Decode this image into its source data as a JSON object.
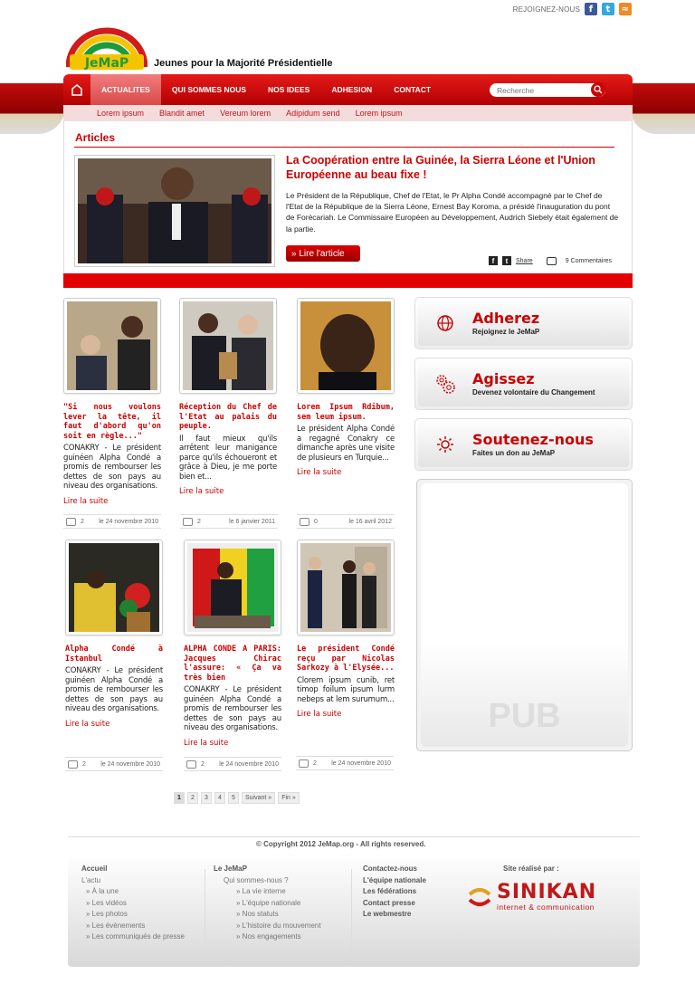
{
  "topbar": {
    "label": "REJOIGNEZ-NOUS"
  },
  "header": {
    "logo_text": "JeMaP",
    "tagline": "Jeunes pour la Majorité Présidentielle"
  },
  "nav": {
    "items": [
      "ACTUALITES",
      "QUI SOMMES NOUS",
      "NOS IDEES",
      "ADHESION",
      "CONTACT"
    ],
    "search_placeholder": "Recherche"
  },
  "subnav": [
    "Lorem ipsum",
    "Blandit amet",
    "Vereum lorem",
    "Adipidum send",
    "Lorem ipsum"
  ],
  "featured": {
    "section": "Articles",
    "title": "La Coopération entre la Guinée, la Sierra Léone et l'Union Européenne au beau fixe !",
    "body": "Le Président de la République, Chef de l'Etat, le Pr Alpha Condé accompagné par le Chef de l'Etat de la République de la Sierra Léone, Ernest Bay Koroma, a présidé l'inauguration du pont de Forécariah. Le Commissaire Européen au Développement, Audrich Siebely était également de la partie.",
    "button": "» Lire l'article",
    "share": "Share",
    "comments": "9 Commentaires"
  },
  "cards": [
    {
      "title": "\"Si nous voulons lever la tête, il faut d'abord qu'on soit en règle...\"",
      "body": "CONAKRY - Le président guinéen Alpha Condé a promis de rembourser les dettes de son pays au niveau des organisations.",
      "more": "Lire la suite",
      "count": "2",
      "date": "le 24 novembre 2010"
    },
    {
      "title": "Réception du Chef de l'Etat au palais du peuple.",
      "body": "Il faut mieux qu'ils arrêtent leur manigance parce qu'ils échoueront et grâce à Dieu, je me porte bien et...",
      "more": "Lire la suite",
      "count": "2",
      "date": "le 6 janvier 2011"
    },
    {
      "title": "Lorem Ipsum Rdibum, sem leum ipsum.",
      "body": "Le président Alpha Condé a regagné Conakry ce dimanche après une visite de plusieurs en Turquie...",
      "more": "Lire la suite",
      "count": "0",
      "date": "le 16 avril 2012"
    },
    {
      "title": "Alpha Condé à Istanbul",
      "body": "CONAKRY - Le président guinéen Alpha Condé a promis de rembourser les dettes de son pays au niveau des organisations.",
      "more": "Lire la suite",
      "count": "2",
      "date": "le 24 novembre 2010"
    },
    {
      "title": "ALPHA CONDE A PARIS: Jacques Chirac l'assure: « Ça va très bien",
      "body": "CONAKRY - Le président guinéen Alpha Condé a promis de rembourser les dettes de son pays au niveau des organisations.",
      "more": "Lire la suite",
      "count": "2",
      "date": "le 24 novembre 2010"
    },
    {
      "title": "Le président Condé reçu par Nicolas Sarkozy à l'Elysée...",
      "body": "Clorem ipsum cunib, ret timop foilum ipsum lurm nebeps at lem surumum...",
      "more": "Lire la suite",
      "count": "2",
      "date": "le 24 novembre 2010"
    }
  ],
  "cta": [
    {
      "title": "Adherez",
      "sub": "Rejoignez le JeMaP",
      "icon": "globe-icon"
    },
    {
      "title": "Agissez",
      "sub": "Devenez volontaire du Changement",
      "icon": "gears-icon"
    },
    {
      "title": "Soutenez-nous",
      "sub": "Faites un don au JeMaP",
      "icon": "sun-icon"
    }
  ],
  "pub": "PUB",
  "pager": [
    "1",
    "2",
    "3",
    "4",
    "5",
    "Suivant »",
    "Fin »"
  ],
  "footer": {
    "copyright": "Copyright 2012 JeMap.org - All rights reserved.",
    "col1": {
      "head": "Accueil",
      "items": [
        "L'actu",
        "» À la une",
        "» Les vidéos",
        "» Les photos",
        "» Les évènements",
        "» Les communiqués de presse"
      ]
    },
    "col2": {
      "head": "Le JeMaP",
      "items": [
        "Qui sommes-nous ?",
        "» La vie interne",
        "» L'équipe nationale",
        "» Nos statuts",
        "» L'histoire du mouvement",
        "» Nos engagements"
      ]
    },
    "col3": {
      "head": "Contactez-nous",
      "items": [
        "L'équipe nationale",
        "Les fédérations",
        "Contact presse",
        "Le webmestre"
      ]
    },
    "col4": {
      "head": "Site réalisé par :",
      "brand": "SINIKAN",
      "brand_sub": "internet & communication"
    }
  },
  "colors": {
    "primary": "#e30000",
    "dark_red": "#b30000",
    "subnav_bg": "#f5dcdc"
  }
}
